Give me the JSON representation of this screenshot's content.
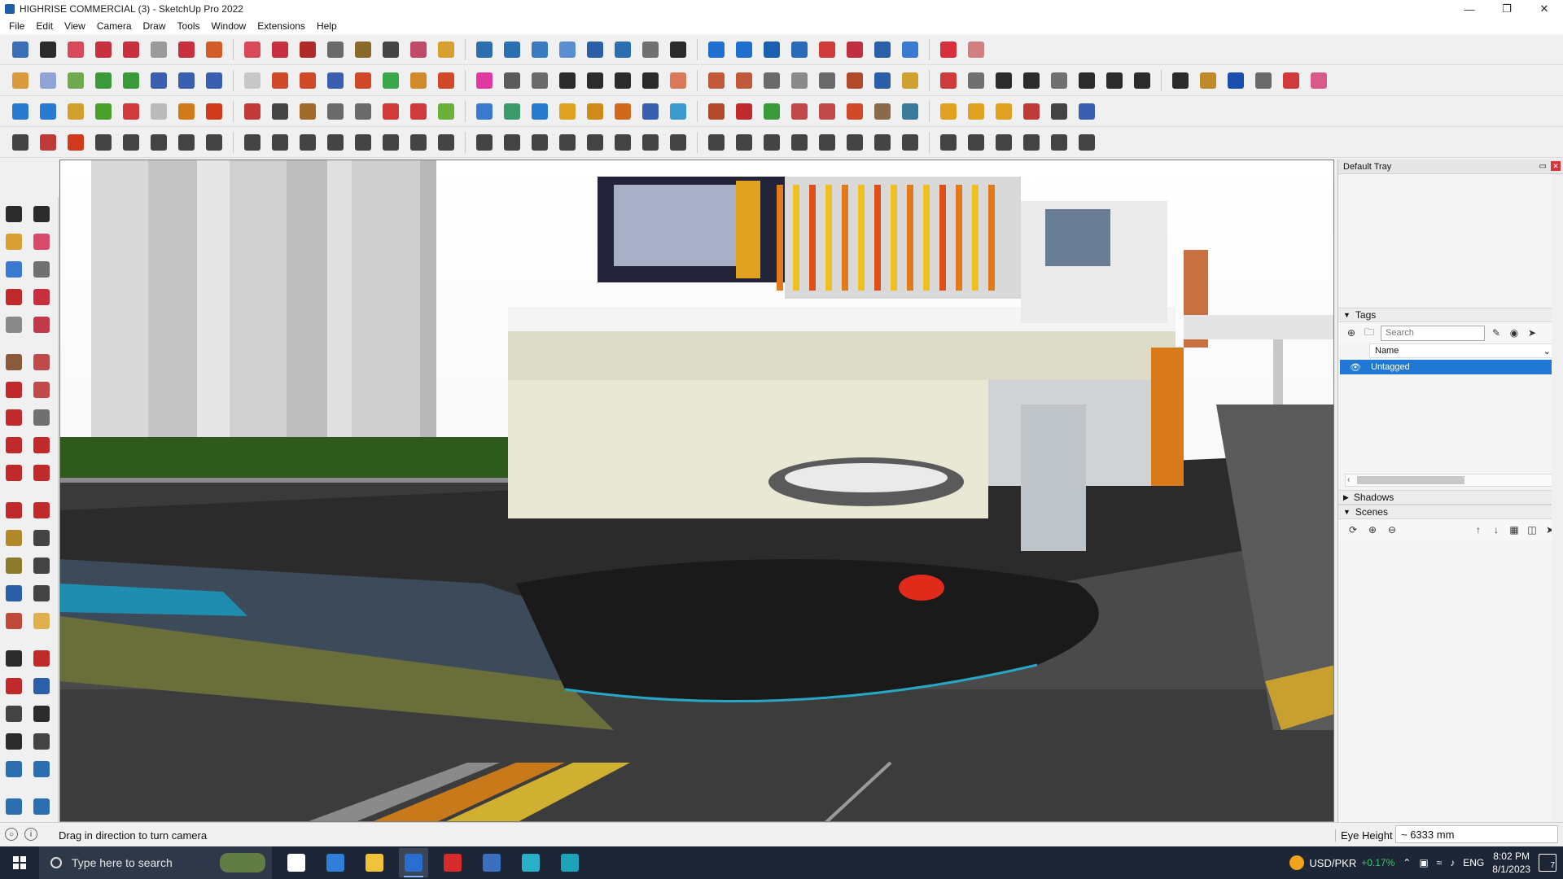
{
  "window": {
    "title": "HIGHRISE COMMERCIAL (3) - SketchUp Pro 2022",
    "controls": [
      "minimize-icon",
      "maximize-icon",
      "close-icon"
    ]
  },
  "menu": [
    "File",
    "Edit",
    "View",
    "Camera",
    "Draw",
    "Tools",
    "Window",
    "Extensions",
    "Help"
  ],
  "toolbars": {
    "row_colors": [
      [
        "#3a6fb5",
        "#2b2b2b",
        "#d84a5a",
        "#c83040",
        "#c83040",
        "#9a9a9a",
        "#c83040",
        "#d35c28",
        "#d84a5a",
        "#c83040",
        "#b02a2a",
        "#6a6a6a",
        "#8a6a2a",
        "#444",
        "#c04a6a",
        "#d8a030",
        "#2b6fb0",
        "#2b6fb0",
        "#3a7abf",
        "#5a8ed0",
        "#2a5fa8",
        "#2b6fb0",
        "#707070",
        "#2b2b2b",
        "#1f6fd0",
        "#1f6fd0",
        "#1a5fb0",
        "#2a6ab8",
        "#d03a3a",
        "#c03040",
        "#2a5faa",
        "#3a7ad0",
        "#d82f3c",
        "#d08080"
      ],
      [
        "#d89a3a",
        "#8fa4d4",
        "#6faa4f",
        "#3a9a3a",
        "#3a9a3a",
        "#3a5fb0",
        "#3a5fb0",
        "#3a5fb0",
        "#c7c7c7",
        "#d04a2a",
        "#d04a2a",
        "#3a5fb0",
        "#d04a2a",
        "#3aa84a",
        "#d08a2a",
        "#d04a2a",
        "#e03aa0",
        "#5a5a5a",
        "#6a6a6a",
        "#2b2b2b",
        "#2b2b2b",
        "#2b2b2b",
        "#2b2b2b",
        "#d87a5a",
        "#c05a3a",
        "#c05a3a",
        "#6a6a6a",
        "#8a8a8a",
        "#6a6a6a",
        "#b04a2a",
        "#2a5fa8",
        "#d0a030",
        "#d03a3a",
        "#707070",
        "#2b2b2b",
        "#2b2b2b",
        "#707070",
        "#2b2b2b",
        "#2b2b2b",
        "#2b2b2b",
        "#2b2b2b",
        "#c08a2a",
        "#1a4fb0",
        "#6a6a6a",
        "#d03a3a",
        "#d85a8a"
      ],
      [
        "#2a7ad0",
        "#2a7ad0",
        "#d0a02a",
        "#4aa02a",
        "#d03a3a",
        "#bbbbbb",
        "#d07a1a",
        "#d03a1a",
        "#c03a3a",
        "#444",
        "#a06a2a",
        "#6a6a6a",
        "#6a6a6a",
        "#d03a3a",
        "#d03a3a",
        "#6ab03a",
        "#3a7ad0",
        "#3a9a6a",
        "#2a7ad0",
        "#e0a020",
        "#d08a1a",
        "#d06a1a",
        "#3a5fb0",
        "#3a9ad0",
        "#b04a2a",
        "#c02a2a",
        "#3a9a3a",
        "#c04a4a",
        "#c04a4a",
        "#d04a2a",
        "#8a6a4a",
        "#3a7a9a",
        "#e0a020",
        "#e0a020",
        "#e0a020",
        "#c03a3a",
        "#444",
        "#3a5fb0"
      ],
      [
        "#444",
        "#c03a3a",
        "#d03a1a",
        "#444",
        "#444",
        "#444",
        "#444",
        "#444",
        "#444",
        "#444",
        "#444",
        "#444",
        "#444",
        "#444",
        "#444",
        "#444",
        "#444",
        "#444",
        "#444",
        "#444",
        "#444",
        "#444",
        "#444",
        "#444",
        "#444",
        "#444",
        "#444",
        "#444",
        "#444",
        "#444",
        "#444",
        "#444",
        "#444",
        "#444",
        "#444",
        "#444",
        "#444",
        "#444"
      ]
    ]
  },
  "left_toolbar": {
    "colors": [
      "#2b2b2b",
      "#2b2b2b",
      "#d8a030",
      "#d84a6a",
      "#3a7ad0",
      "#707070",
      "#c02a2a",
      "#c83040",
      "#8a8a8a",
      "#c03a4a",
      "#8a5a3a",
      "#c04a4a",
      "#c02a2a",
      "#c04a4a",
      "#c02a2a",
      "#707070",
      "#c02a2a",
      "#c02a2a",
      "#c02a2a",
      "#c02a2a",
      "#c02a2a",
      "#c02a2a",
      "#b08a2a",
      "#444",
      "#8a7a2a",
      "#444",
      "#2a5fa8",
      "#444",
      "#c04a3a",
      "#e0b050",
      "#2b2b2b",
      "#c02a2a",
      "#c02a2a",
      "#2b5fa8",
      "#444",
      "#2b2b2b",
      "#2b2b2b",
      "#444",
      "#2b6fb0",
      "#2b6fb0",
      "#2b6fb0",
      "#2b6fb0"
    ]
  },
  "tray": {
    "title": "Default Tray",
    "tags": {
      "label": "Tags",
      "search_placeholder": "Search",
      "column_name": "Name",
      "rows": [
        {
          "name": "Untagged"
        }
      ]
    },
    "shadows": {
      "label": "Shadows"
    },
    "scenes": {
      "label": "Scenes"
    }
  },
  "status": {
    "message": "Drag in direction to turn camera",
    "measure_label": "Eye Height",
    "measure_value": "~ 6333 mm"
  },
  "taskbar": {
    "search_placeholder": "Type here to search",
    "apps": [
      {
        "name": "task-view-icon",
        "color": "#ffffff"
      },
      {
        "name": "calculator-icon",
        "color": "#2f7fd8"
      },
      {
        "name": "file-explorer-icon",
        "color": "#f2c23a"
      },
      {
        "name": "sketchup-icon",
        "color": "#2a6fd0"
      },
      {
        "name": "acrobat-icon",
        "color": "#d62b2b"
      },
      {
        "name": "calendar-app-icon",
        "color": "#3a6fc0"
      },
      {
        "name": "edge-icon",
        "color": "#2ab0c8"
      },
      {
        "name": "3dsmax-icon",
        "color": "#1fa3b8"
      }
    ],
    "ticker": {
      "pair": "USD/PKR",
      "change": "+0.17%"
    },
    "lang": "ENG",
    "time": "8:02 PM",
    "date": "8/1/2023",
    "notification_count": "7"
  }
}
